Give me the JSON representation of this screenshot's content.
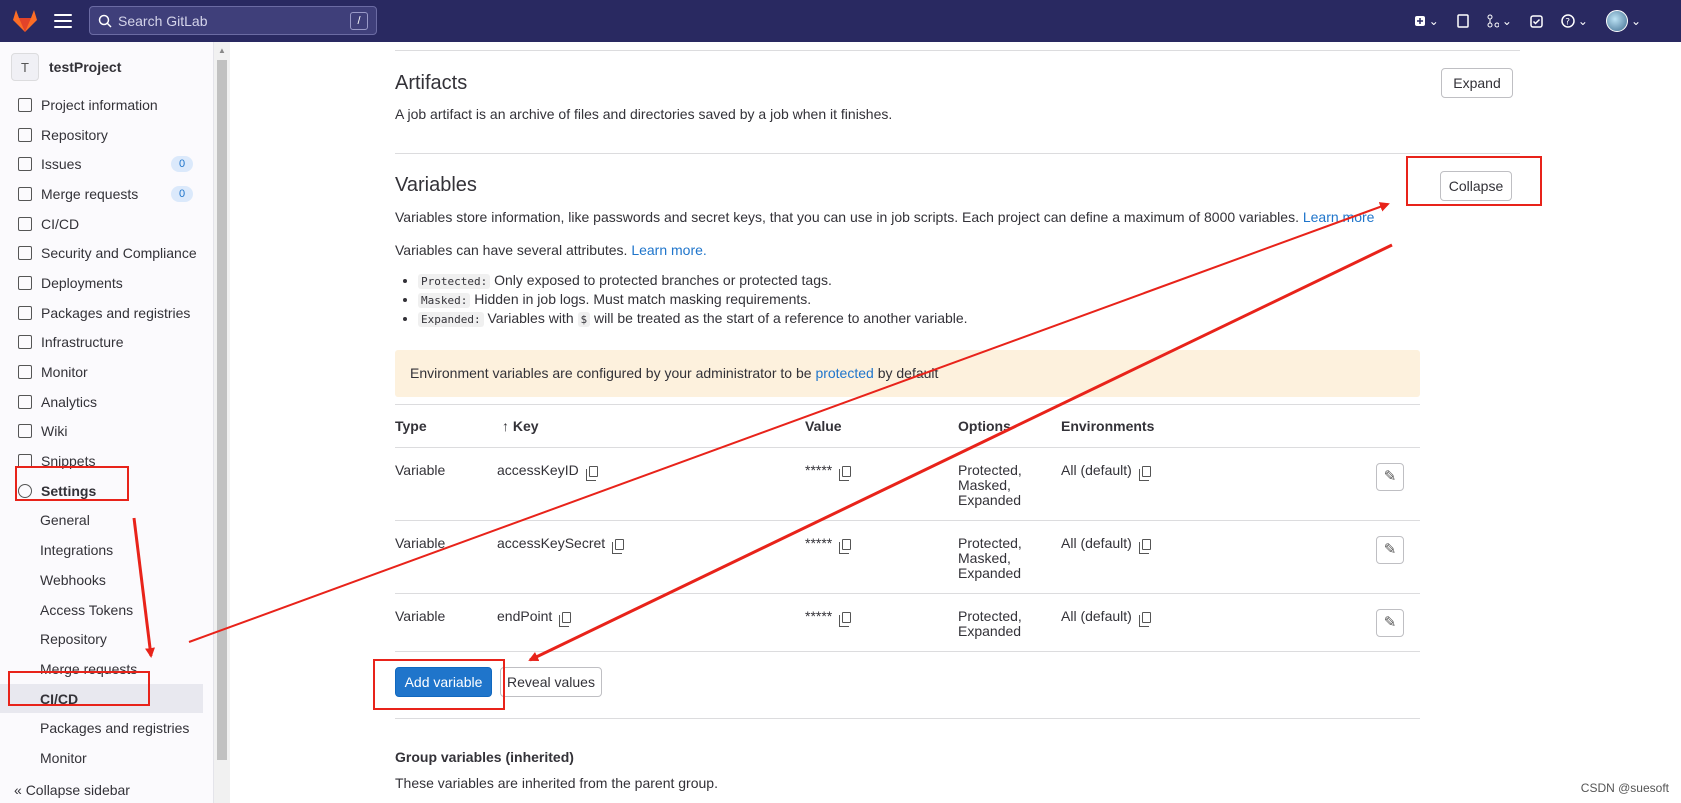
{
  "header": {
    "search_placeholder": "Search GitLab",
    "search_shortcut": "/"
  },
  "sidebar": {
    "project_initial": "T",
    "project_name": "testProject",
    "items": [
      {
        "label": "Project information"
      },
      {
        "label": "Repository"
      },
      {
        "label": "Issues",
        "badge": "0"
      },
      {
        "label": "Merge requests",
        "badge": "0"
      },
      {
        "label": "CI/CD"
      },
      {
        "label": "Security and Compliance"
      },
      {
        "label": "Deployments"
      },
      {
        "label": "Packages and registries"
      },
      {
        "label": "Infrastructure"
      },
      {
        "label": "Monitor"
      },
      {
        "label": "Analytics"
      },
      {
        "label": "Wiki"
      },
      {
        "label": "Snippets"
      },
      {
        "label": "Settings"
      }
    ],
    "settings_sub": [
      "General",
      "Integrations",
      "Webhooks",
      "Access Tokens",
      "Repository",
      "Merge requests",
      "CI/CD",
      "Packages and registries",
      "Monitor"
    ],
    "collapse_label": "Collapse sidebar"
  },
  "artifacts": {
    "title": "Artifacts",
    "description": "A job artifact is an archive of files and directories saved by a job when it finishes.",
    "expand_label": "Expand"
  },
  "variables": {
    "title": "Variables",
    "description": "Variables store information, like passwords and secret keys, that you can use in job scripts. Each project can define a maximum of 8000 variables.",
    "learn_more": "Learn more",
    "attributes_intro": "Variables can have several attributes.",
    "attributes_learn_more": "Learn more.",
    "collapse_label": "Collapse",
    "attributes": [
      {
        "code": "Protected:",
        "text": "Only exposed to protected branches or protected tags."
      },
      {
        "code": "Masked:",
        "text": "Hidden in job logs. Must match masking requirements."
      },
      {
        "code": "Expanded:",
        "text_before": "Variables with",
        "code2": "$",
        "text_after": "will be treated as the start of a reference to another variable."
      }
    ],
    "alert_before": "Environment variables are configured by your administrator to be",
    "alert_link": "protected",
    "alert_after": "by default",
    "columns": {
      "type": "Type",
      "key": "Key",
      "key_sort": "↑",
      "value": "Value",
      "options": "Options",
      "environments": "Environments"
    },
    "rows": [
      {
        "type": "Variable",
        "key": "accessKeyID",
        "value": "*****",
        "options": [
          "Protected,",
          "Masked,",
          "Expanded"
        ],
        "environment": "All (default)"
      },
      {
        "type": "Variable",
        "key": "accessKeySecret",
        "value": "*****",
        "options": [
          "Protected,",
          "Masked,",
          "Expanded"
        ],
        "environment": "All (default)"
      },
      {
        "type": "Variable",
        "key": "endPoint",
        "value": "*****",
        "options": [
          "Protected,",
          "Expanded"
        ],
        "environment": "All (default)"
      }
    ],
    "add_label": "Add variable",
    "reveal_label": "Reveal values"
  },
  "group_variables": {
    "title": "Group variables (inherited)",
    "description": "These variables are inherited from the parent group."
  },
  "watermark": "CSDN @suesoft",
  "colors": {
    "annotation": "#e8231a",
    "primary": "#1f75cb",
    "topbar": "#292961"
  }
}
